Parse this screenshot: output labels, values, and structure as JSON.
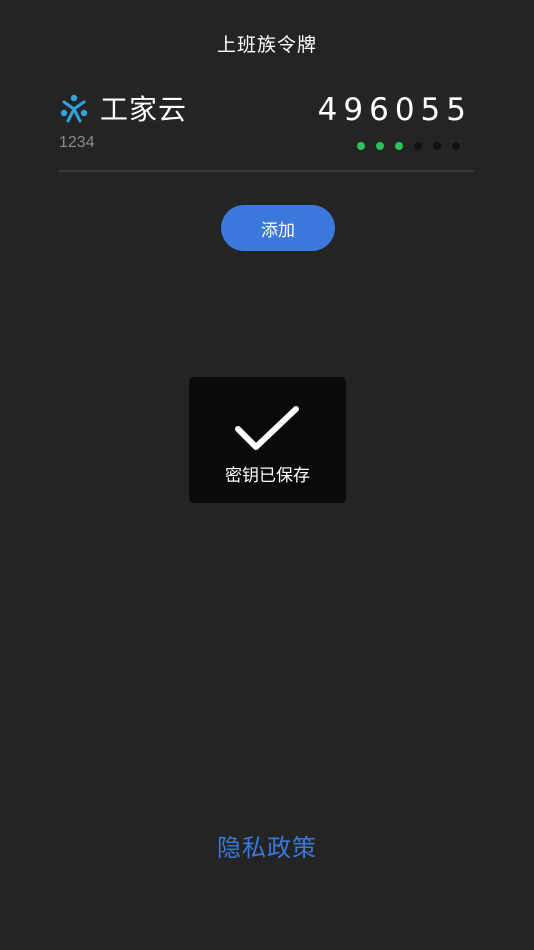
{
  "header": {
    "title": "上班族令牌"
  },
  "account": {
    "icon": "people-logo-icon",
    "brand": "工家云",
    "id": "1234",
    "otp": "496055",
    "timer": {
      "total_dots": 6,
      "active_dots": 3,
      "active_color": "#27c25a"
    }
  },
  "actions": {
    "add_label": "添加"
  },
  "toast": {
    "icon": "checkmark-icon",
    "message": "密钥已保存"
  },
  "footer": {
    "privacy_label": "隐私政策"
  },
  "colors": {
    "background": "#242424",
    "accent": "#3a78dc",
    "brand_icon": "#2ea3e0"
  }
}
